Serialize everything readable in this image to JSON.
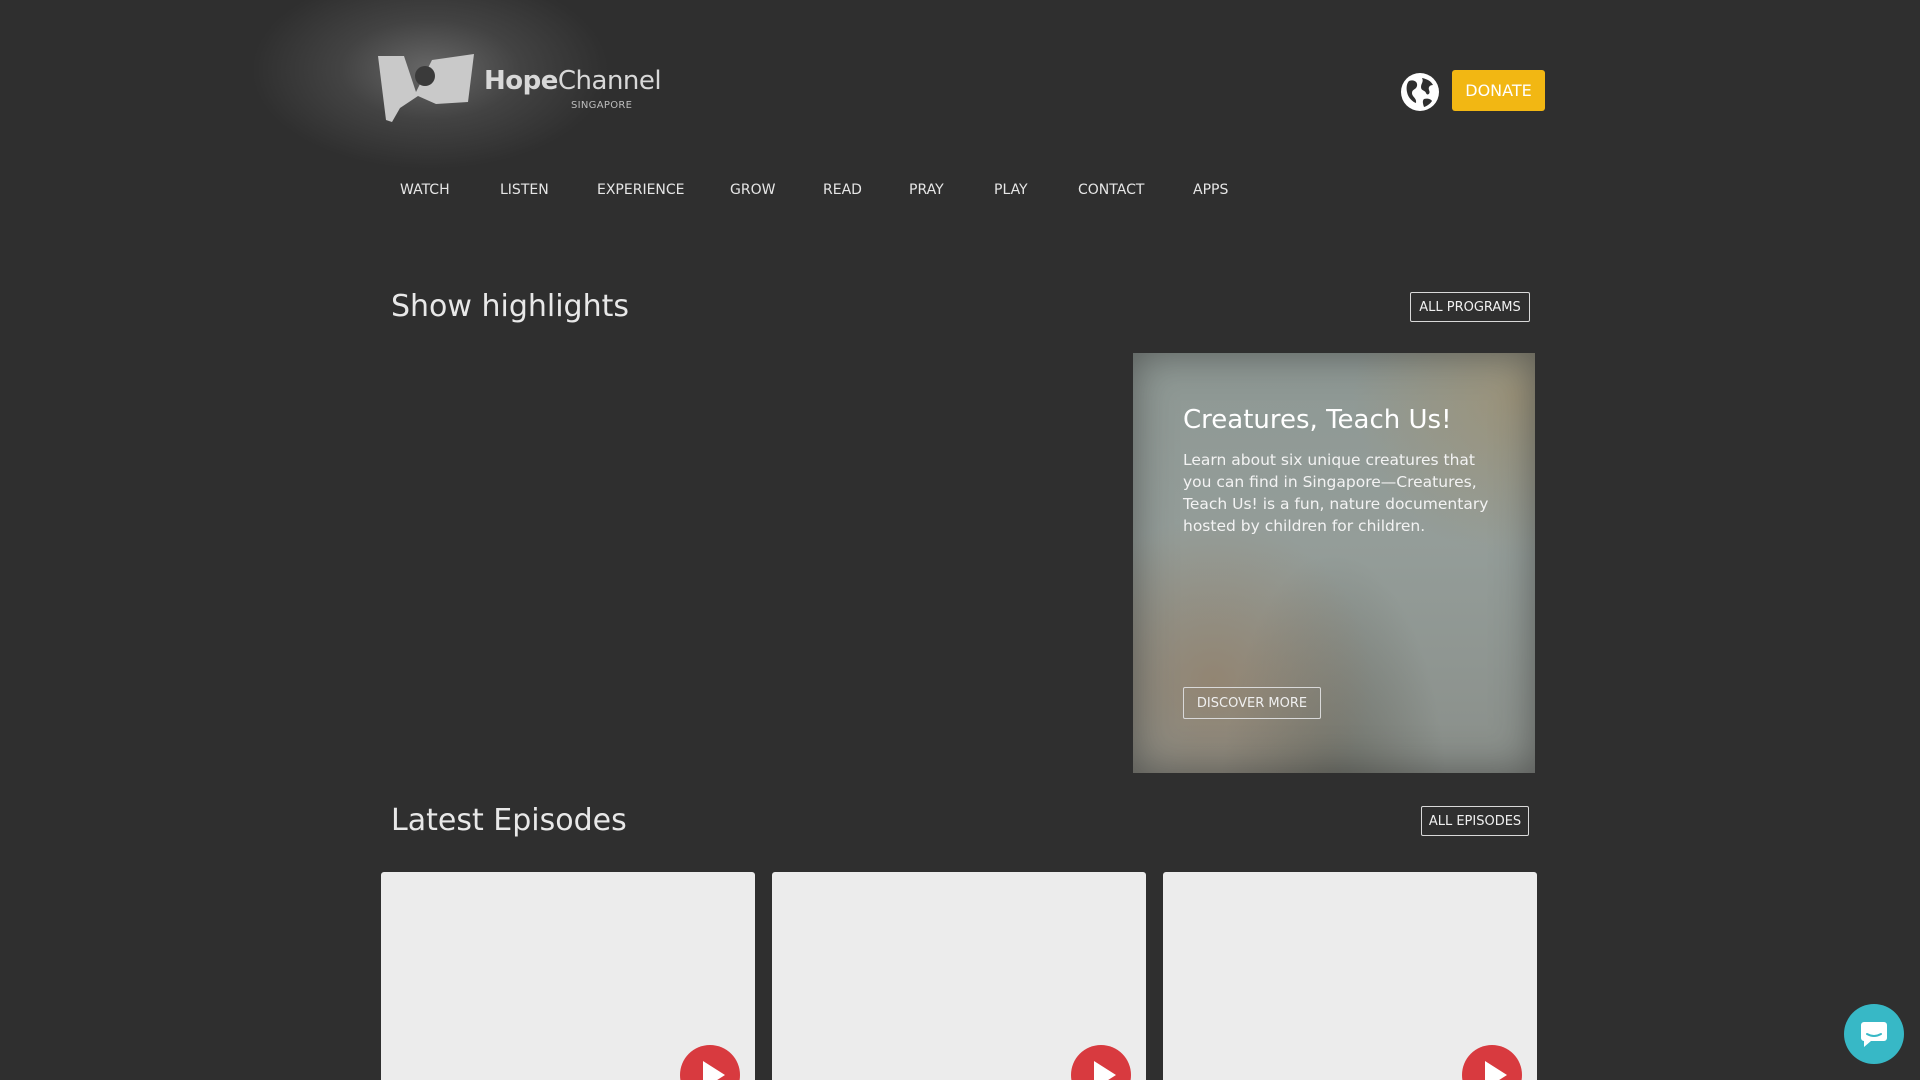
{
  "header": {
    "logo_bold": "Hope",
    "logo_light": "Channel",
    "logo_sub": "SINGAPORE",
    "donate_label": "DONATE"
  },
  "nav": {
    "items": [
      "WATCH",
      "LISTEN",
      "EXPERIENCE",
      "GROW",
      "READ",
      "PRAY",
      "PLAY",
      "CONTACT",
      "APPS"
    ]
  },
  "highlights": {
    "title": "Show highlights",
    "all_programs_label": "ALL PROGRAMS",
    "feature": {
      "title": "Creatures, Teach Us!",
      "description": "Learn about six unique creatures that you can find in Singapore—Creatures, Teach Us! is a fun, nature documentary hosted by children for children.",
      "cta_label": "DISCOVER MORE"
    }
  },
  "episodes": {
    "title": "Latest Episodes",
    "all_episodes_label": "ALL EPISODES",
    "card_count_note": ""
  },
  "icons": {
    "globe": "globe-icon",
    "play": "play-icon",
    "chat": "chat-icon"
  },
  "colors": {
    "background": "#2f2f2f",
    "donate": "#f2b713",
    "play": "#d83a3f",
    "chat": "#37b8c6",
    "card": "#ececec"
  }
}
